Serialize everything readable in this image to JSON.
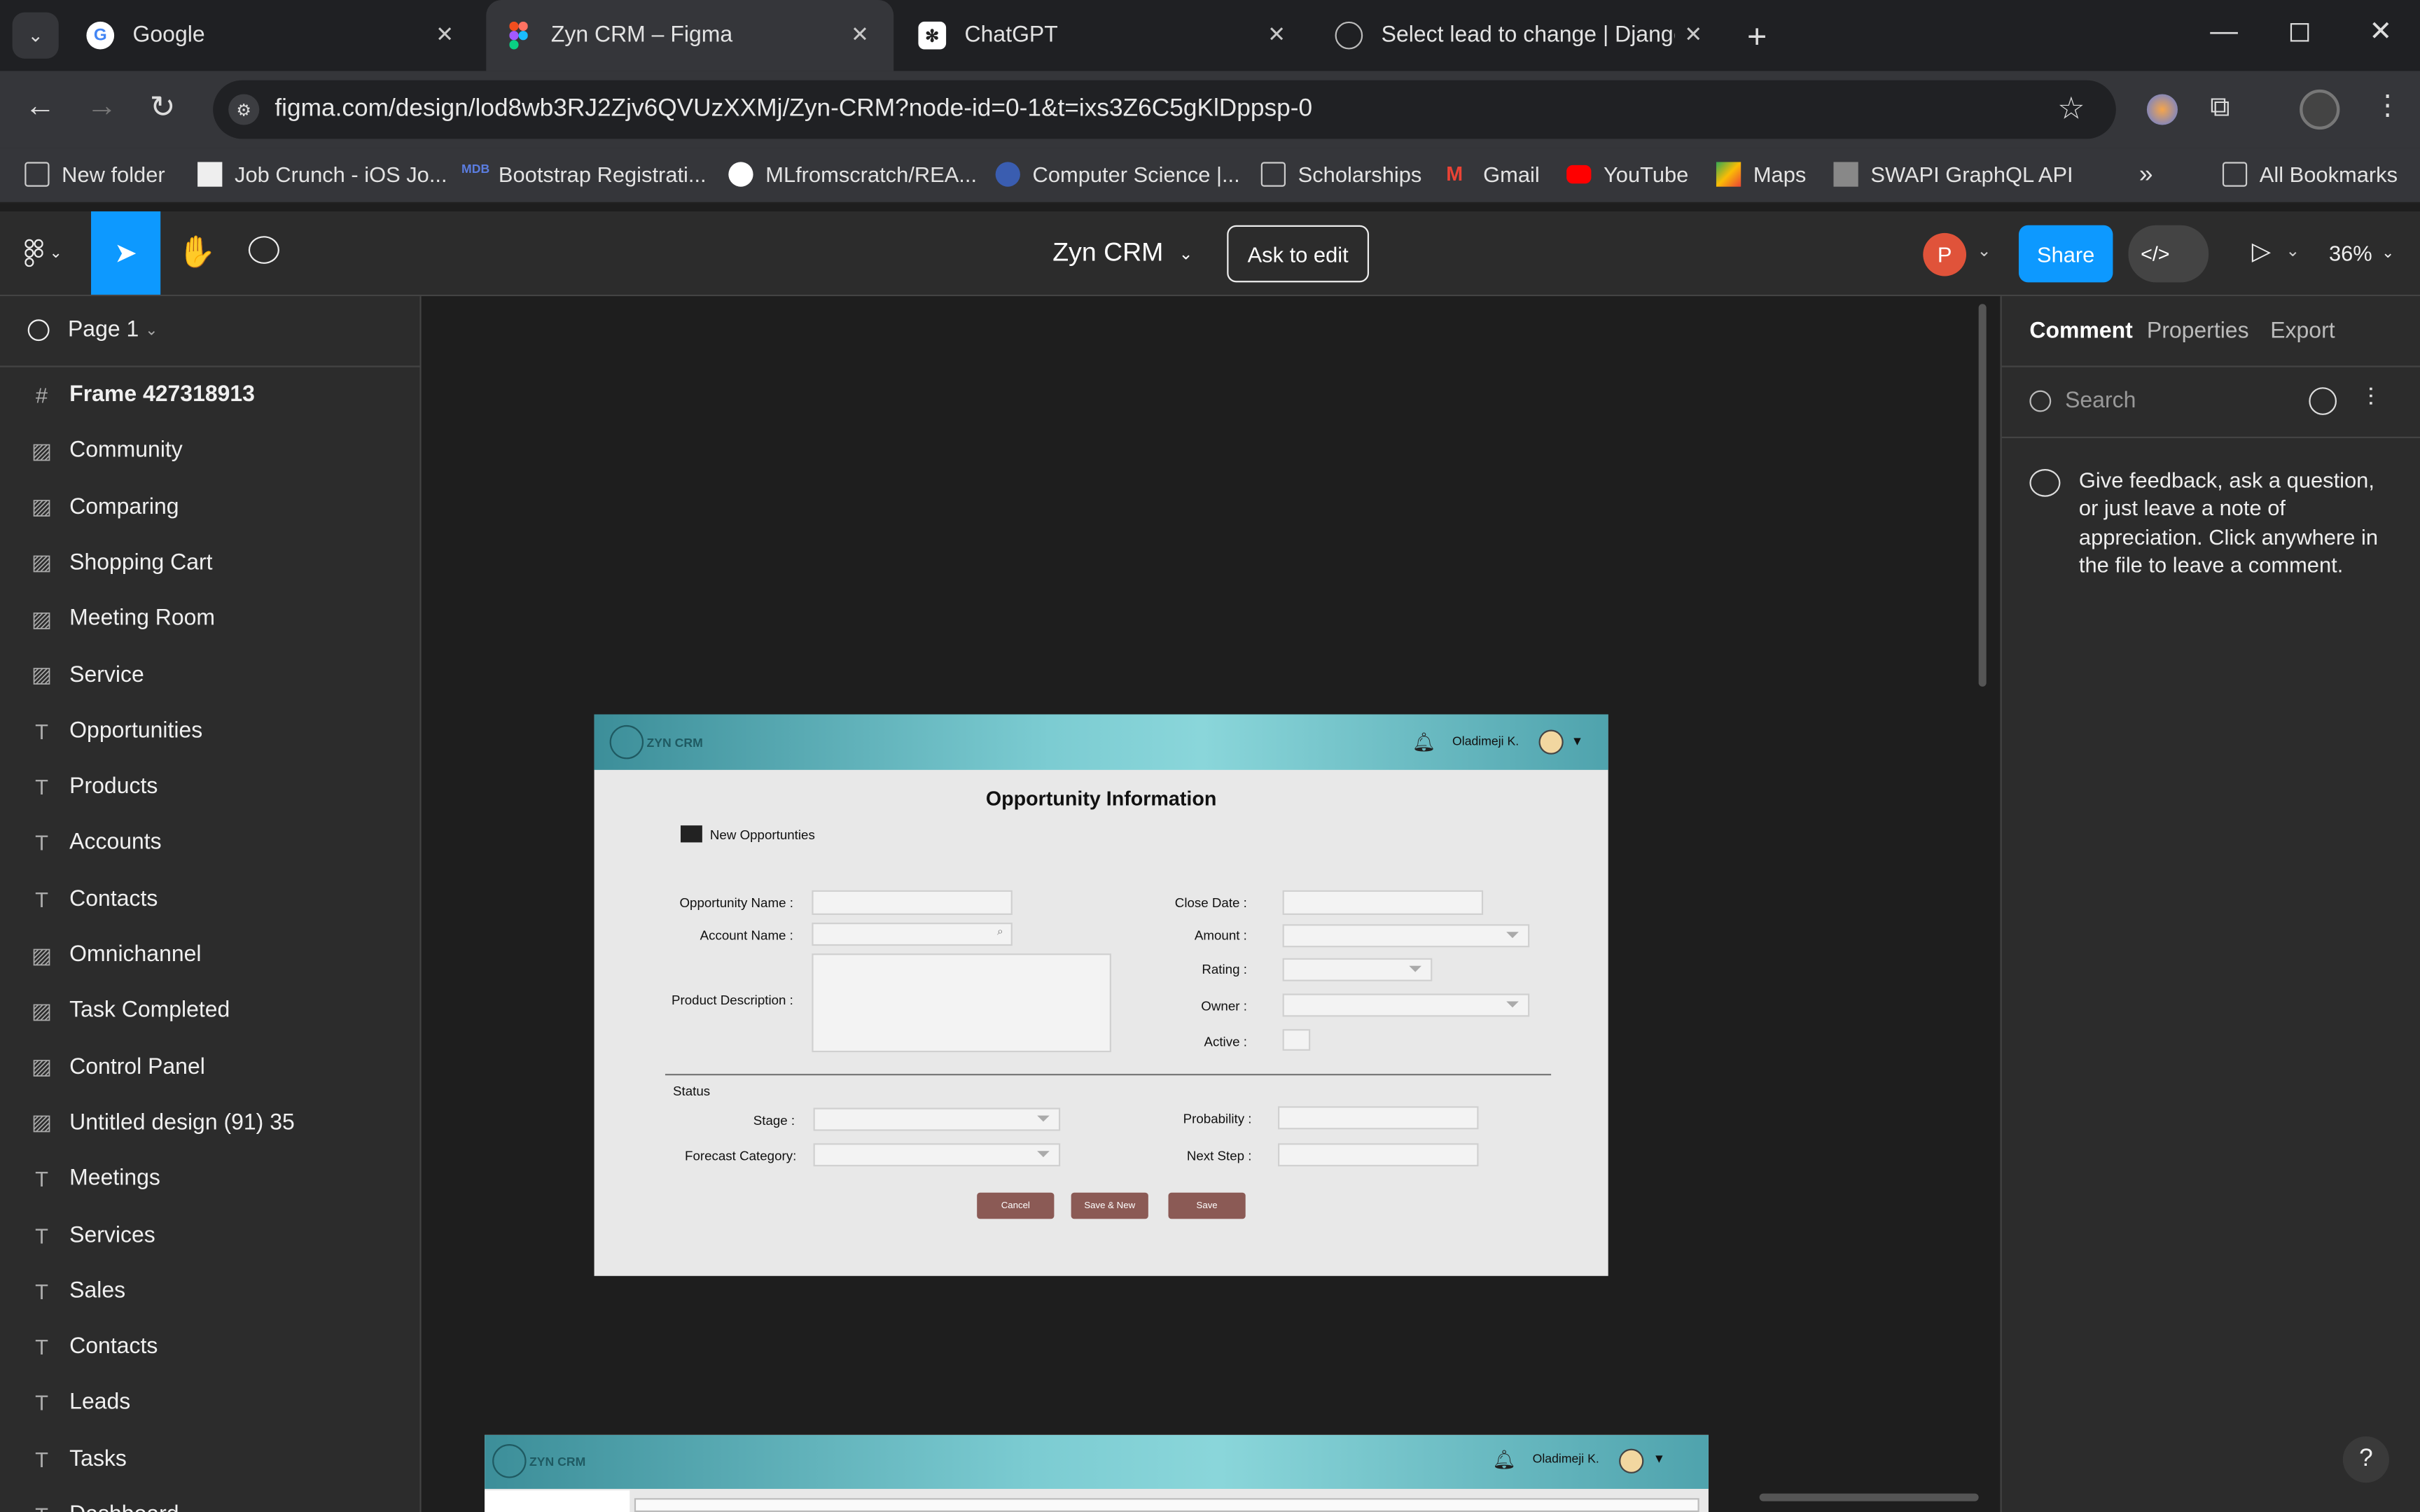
{
  "browser": {
    "tabs": [
      {
        "title": "Google",
        "icon": "google-icon"
      },
      {
        "title": "Zyn CRM – Figma",
        "icon": "figma-icon"
      },
      {
        "title": "ChatGPT",
        "icon": "chatgpt-icon"
      },
      {
        "title": "Select lead to change | Django s",
        "icon": "globe-icon"
      }
    ],
    "url": "figma.com/design/lod8wb3RJ2Zjv6QVUzXXMj/Zyn-CRM?node-id=0-1&t=ixs3Z6C5gKlDppsp-0",
    "bookmarks": [
      "New folder",
      "Job Crunch - iOS Jo...",
      "Bootstrap Registrati...",
      "MLfromscratch/REA...",
      "Computer Science |...",
      "Scholarships",
      "Gmail",
      "YouTube",
      "Maps",
      "SWAPI GraphQL API"
    ],
    "all_bookmarks": "All Bookmarks"
  },
  "figma": {
    "file_name": "Zyn CRM",
    "ask_to_edit": "Ask to edit",
    "share": "Share",
    "zoom": "36%",
    "avatar_initial": "P",
    "page": "Page 1",
    "layers": [
      {
        "name": "Frame 427318913",
        "icon": "frame-icon"
      },
      {
        "name": "Community",
        "icon": "image-icon"
      },
      {
        "name": "Comparing",
        "icon": "image-icon"
      },
      {
        "name": "Shopping Cart",
        "icon": "image-icon"
      },
      {
        "name": "Meeting Room",
        "icon": "image-icon"
      },
      {
        "name": "Service",
        "icon": "image-icon"
      },
      {
        "name": "Opportunities",
        "icon": "text-icon"
      },
      {
        "name": "Products",
        "icon": "text-icon"
      },
      {
        "name": "Accounts",
        "icon": "text-icon"
      },
      {
        "name": "Contacts",
        "icon": "text-icon"
      },
      {
        "name": "Omnichannel",
        "icon": "image-icon"
      },
      {
        "name": "Task Completed",
        "icon": "image-icon"
      },
      {
        "name": "Control Panel",
        "icon": "image-icon"
      },
      {
        "name": "Untitled design (91) 35",
        "icon": "image-icon"
      },
      {
        "name": "Meetings",
        "icon": "text-icon"
      },
      {
        "name": "Services",
        "icon": "text-icon"
      },
      {
        "name": "Sales",
        "icon": "text-icon"
      },
      {
        "name": "Contacts",
        "icon": "text-icon"
      },
      {
        "name": "Leads",
        "icon": "text-icon"
      },
      {
        "name": "Tasks",
        "icon": "text-icon"
      },
      {
        "name": "Dashboard",
        "icon": "text-icon"
      }
    ],
    "right_tabs": [
      "Comment",
      "Properties",
      "Export"
    ],
    "search_placeholder": "Search",
    "comment_hint": "Give feedback, ask a question, or just leave a note of appreciation. Click anywhere in the file to leave a comment."
  },
  "design": {
    "logo": "ZYN CRM",
    "user": "Oladimeji K.",
    "title": "Opportunity Information",
    "section": "New Opportunties",
    "labels": {
      "opportunity_name": "Opportunity Name :",
      "account_name": "Account Name :",
      "product_description": "Product Description :",
      "close_date": "Close Date :",
      "amount": "Amount :",
      "rating": "Rating :",
      "owner": "Owner :",
      "active": "Active :",
      "status": "Status",
      "stage": "Stage :",
      "forecast": "Forecast Category:",
      "probability": "Probability :",
      "next_step": "Next Step :"
    },
    "buttons": {
      "cancel": "Cancel",
      "save_new": "Save & New",
      "save": "Save"
    },
    "accent": "#8b5a55"
  }
}
